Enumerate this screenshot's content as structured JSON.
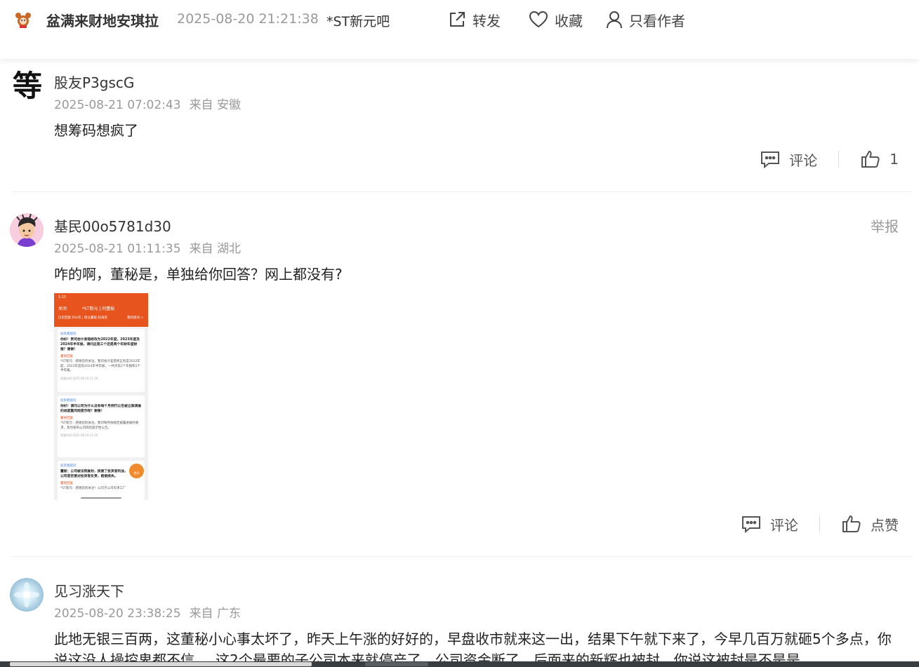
{
  "header": {
    "author_name": "盆满来财地安琪拉",
    "post_time": "2025-08-20 21:21:38",
    "forum_name": "*ST新元吧",
    "share_label": "转发",
    "favorite_label": "收藏",
    "author_only_label": "只看作者"
  },
  "comments": [
    {
      "username": "股友P3gscG",
      "time": "2025-08-21 07:02:43",
      "location": "来自 安徽",
      "text": "想筹码想疯了",
      "comment_label": "评论",
      "like_label": "1",
      "avatar_glyph": "等"
    },
    {
      "username": "基民00o5781d30",
      "time": "2025-08-21 01:11:35",
      "location": "来自 湖北",
      "text": "咋的啊，董秘是，单独给你回答？网上都没有?",
      "comment_label": "评论",
      "like_label": "点赞",
      "report_label": "举报"
    },
    {
      "username": "见习涨天下",
      "time": "2025-08-20 23:38:25",
      "location": "来自 广东",
      "text": "此地无银三百两，这董秘小心事太坏了，昨天上午涨的好好的，早盘收市就来这一出，结果下午就下来了，今早几百万就砸5个多点，你说这没人操控卑都不信。。这2个最要的子公司本来就停产了，公司资金断了，后面来的新辉也被封，你说这被封是不是是"
    }
  ],
  "screenshot": {
    "status_time": "1:10",
    "nav_title": "*ST新元 | 问董秘",
    "nav_back": "关闭",
    "summary": "历史回复 654次 | 现任董秘 赵海英",
    "summary_link": "我的提问 >",
    "cards": [
      {
        "asker": "投资者提问",
        "question": "你好！贵司会计差错修改为2022年度，2023年度及2024年半年报，请问这是三个还是两个年财年度财报？谢谢！",
        "answer_head": "董秘回复",
        "answer": "*ST新元：感谢您的关注。我司会计差错修正的是2022年度、2023年度及2024年半年报，一共涉及2个年报和1个半年报。",
        "time": "答复时间 2025-08-19 11:20"
      },
      {
        "asker": "投资者提问",
        "question": "你好！请问公司为什么没有每个月例行公告被立案调查的进度暨风险提示呢？谢谢！",
        "answer_head": "董秘回复",
        "answer": "*ST新元：感谢您的关注。我司每月按规定披露进展的要求，及时发布公司风险提示性公告。",
        "time": "答复时间 2025-08-19 11:20"
      },
      {
        "asker": "投资者提问",
        "question": "董秘：公司被法院查封，损害了投资者利益，公司是否要对投资者负责，赔偿损失。",
        "answer_head": "董秘回复",
        "answer": "*ST新元：感谢您的关注！公司子公司天津工厂",
        "time": ""
      }
    ],
    "fab_label": "提问"
  },
  "colors": {
    "accent_orange": "#e8541e",
    "meta_gray": "#999999",
    "text_dark": "#222222"
  }
}
